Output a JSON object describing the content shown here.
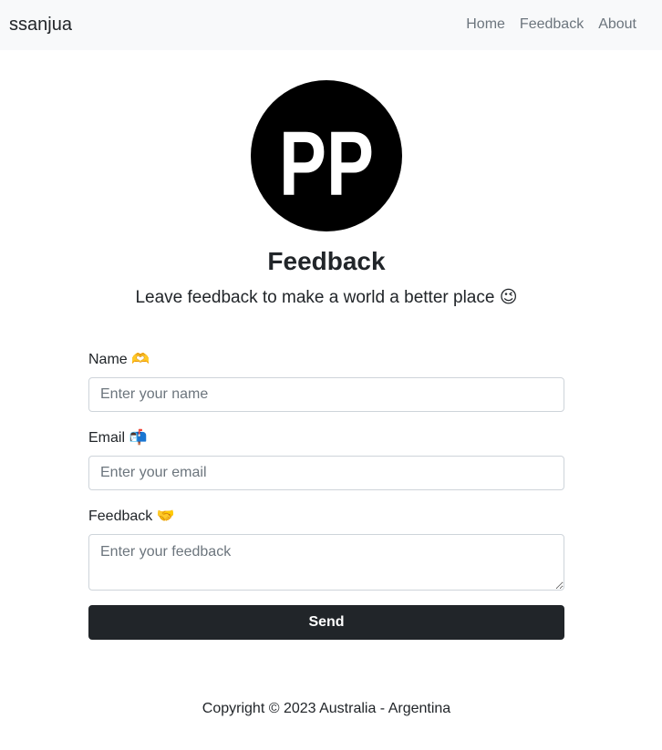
{
  "navbar": {
    "brand": "ssanjua",
    "links": [
      {
        "label": "Home"
      },
      {
        "label": "Feedback"
      },
      {
        "label": "About"
      }
    ]
  },
  "logo": {
    "text": "PP",
    "icon": "pp-logo-circle"
  },
  "main": {
    "title": "Feedback",
    "subtitle": "Leave feedback to make a world a better place 😉"
  },
  "form": {
    "name": {
      "label": "Name 🫶",
      "placeholder": "Enter your name",
      "value": ""
    },
    "email": {
      "label": "Email 📬",
      "placeholder": "Enter your email",
      "value": ""
    },
    "feedback": {
      "label": "Feedback 🤝",
      "placeholder": "Enter your feedback",
      "value": ""
    },
    "send_label": "Send"
  },
  "footer": {
    "text": "Copyright © 2023 Australia - Argentina"
  },
  "colors": {
    "navbar_bg": "#f8f9fa",
    "button_bg": "#212529",
    "text": "#212529",
    "muted": "#6c757d"
  }
}
